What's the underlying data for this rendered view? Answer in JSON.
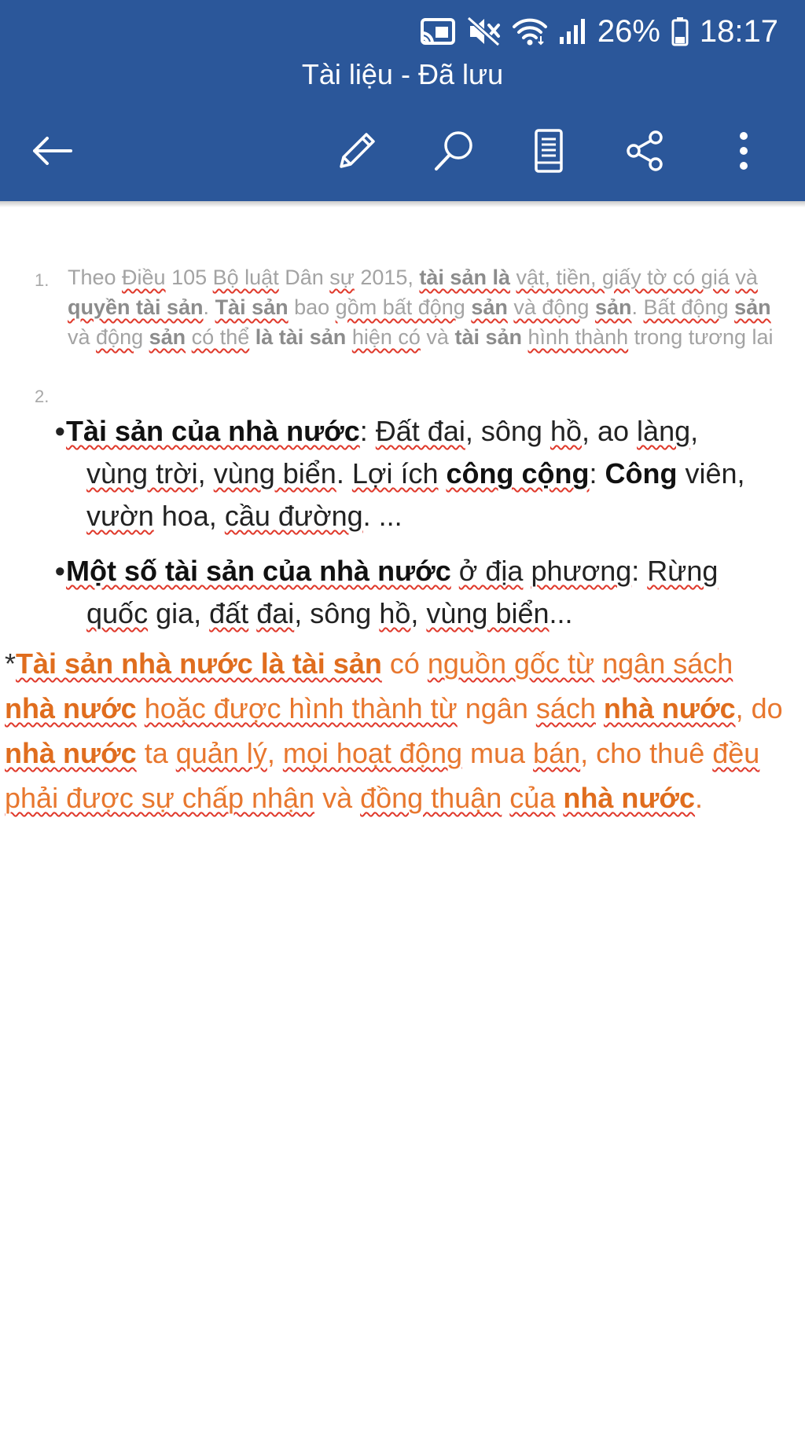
{
  "status_bar": {
    "battery": "26%",
    "time": "18:17",
    "icons": [
      "cast-icon",
      "mute-icon",
      "wifi-icon",
      "signal-icon",
      "battery-icon"
    ]
  },
  "app_bar": {
    "title": "Tài liệu - Đã lưu",
    "background": "#2b579a",
    "actions": [
      "back-arrow-icon",
      "edit-pencil-icon",
      "search-icon",
      "mobile-view-icon",
      "share-icon",
      "more-vertical-icon"
    ]
  },
  "document": {
    "list_numbers": [
      "1.",
      "2."
    ],
    "item1": {
      "t1": "Theo ",
      "t2": "Điều",
      "t3": " 105 ",
      "t4": "Bộ luật",
      "t5": " Dân ",
      "t6": "sự",
      "t7": " 2015, ",
      "b1": "tài sản là",
      "t8": " ",
      "t9": "vật, tiền, giấy tờ có giá",
      "t10": " ",
      "t11": "và",
      "t12": " ",
      "b2": "quyền tài sản",
      "t13": ". ",
      "b3": "Tài sản",
      "t14": " bao ",
      "t15": "gồm bất động",
      "t16": " ",
      "b4": "sản",
      "t17": " ",
      "t18": "và động",
      "t19": " ",
      "b5": "sản",
      "t20": ". ",
      "t21": "Bất động",
      "t22": " ",
      "b6": "sản",
      "t23": " và ",
      "t24": "động",
      "t25": " ",
      "b7": "sản",
      "t26": " ",
      "t27": "có thể",
      "t28": " ",
      "b8": "là tài sản",
      "t29": " ",
      "t30": "hiện có",
      "t31": " ",
      "t32": "và",
      "t33": " ",
      "b9": "tài sản",
      "t34": " ",
      "t35": "hình thành",
      "t36": " ",
      "t37": "trong tương lai"
    },
    "bullet1": {
      "b1": "Tài sản của nhà nước",
      "t1": ": ",
      "t2": "Đất đai",
      "t3": ", sông ",
      "t4": "hồ",
      "t5": ", ao ",
      "t6": "làng",
      "t7": ",",
      "t8": "vùng trời",
      "t9": ", ",
      "t10": "vùng biển",
      "t11": ". ",
      "t12": "Lợi ích",
      "t13": " ",
      "b2": "công cộng",
      "t14": ": ",
      "b3": "Công",
      "t15": " viên,",
      "t16": "vườn",
      "t17": " hoa, ",
      "t18": "cầu đường",
      "t19": ". ..."
    },
    "bullet2": {
      "b1": "Một số tài sản của nhà nước",
      "t1": " ",
      "t2": "ở địa",
      "t3": " ",
      "t4": "phương",
      "t5": ": ",
      "t6": "Rừng",
      "t7": "quốc",
      "t8": " gia, ",
      "t9": "đất",
      "t10": " ",
      "t11": "đai",
      "t12": ", sông ",
      "t13": "hồ",
      "t14": ", ",
      "t15": "vùng biển",
      "t16": "..."
    },
    "note": {
      "star": "*",
      "b1": "Tài sản nhà nước là tài sản",
      "t1": " có ",
      "t2": "nguồn gốc từ",
      "t3": " ",
      "t4": "ngân sách",
      "t5": " ",
      "b2": "nhà nước",
      "t6": " ",
      "t7": "hoặc được hình thành từ",
      "t8": " ngân ",
      "t9": "sách",
      "t10": " ",
      "b3": "nhà nước",
      "t11": ", do ",
      "b4": "nhà nước",
      "t12": " ta ",
      "t13": "quản lý",
      "t14": ", ",
      "t15": "mọi hoạt động",
      "t16": " mua ",
      "t17": "bán",
      "t18": ", cho thuê ",
      "t19": "đều phải được sự chấp nhận",
      "t20": " và ",
      "t21": "đồng thuận",
      "t22": " ",
      "t23": "của",
      "t24": " ",
      "b5": "nhà nước",
      "t25": "."
    }
  }
}
